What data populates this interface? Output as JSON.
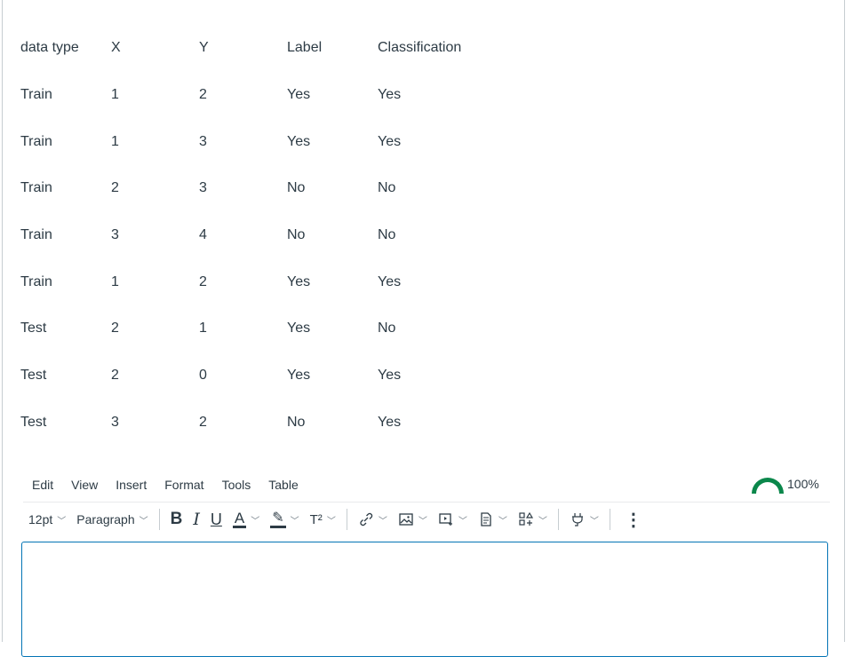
{
  "table": {
    "headers": [
      "data type",
      "X",
      "Y",
      "Label",
      "Classification"
    ],
    "rows": [
      [
        "Train",
        "1",
        "2",
        "Yes",
        "Yes"
      ],
      [
        "Train",
        "1",
        "3",
        "Yes",
        "Yes"
      ],
      [
        "Train",
        "2",
        "3",
        "No",
        "No"
      ],
      [
        "Train",
        "3",
        "4",
        "No",
        "No"
      ],
      [
        "Train",
        "1",
        "2",
        "Yes",
        "Yes"
      ],
      [
        "Test",
        "2",
        "1",
        "Yes",
        "No"
      ],
      [
        "Test",
        "2",
        "0",
        "Yes",
        "Yes"
      ],
      [
        "Test",
        "3",
        "2",
        "No",
        "Yes"
      ]
    ]
  },
  "editor": {
    "menu": [
      "Edit",
      "View",
      "Insert",
      "Format",
      "Tools",
      "Table"
    ],
    "accessibility_score": "100%",
    "font_size": "12pt",
    "block_format": "Paragraph",
    "bold_label": "B",
    "italic_label": "I",
    "underline_label": "U",
    "text_color_label": "A",
    "superscript_label": "T²",
    "more_label": "⋮",
    "content": ""
  },
  "colors": {
    "text": "#2d3b45",
    "editor_border": "#0374b5",
    "a11y_indicator": "#0b874b"
  }
}
